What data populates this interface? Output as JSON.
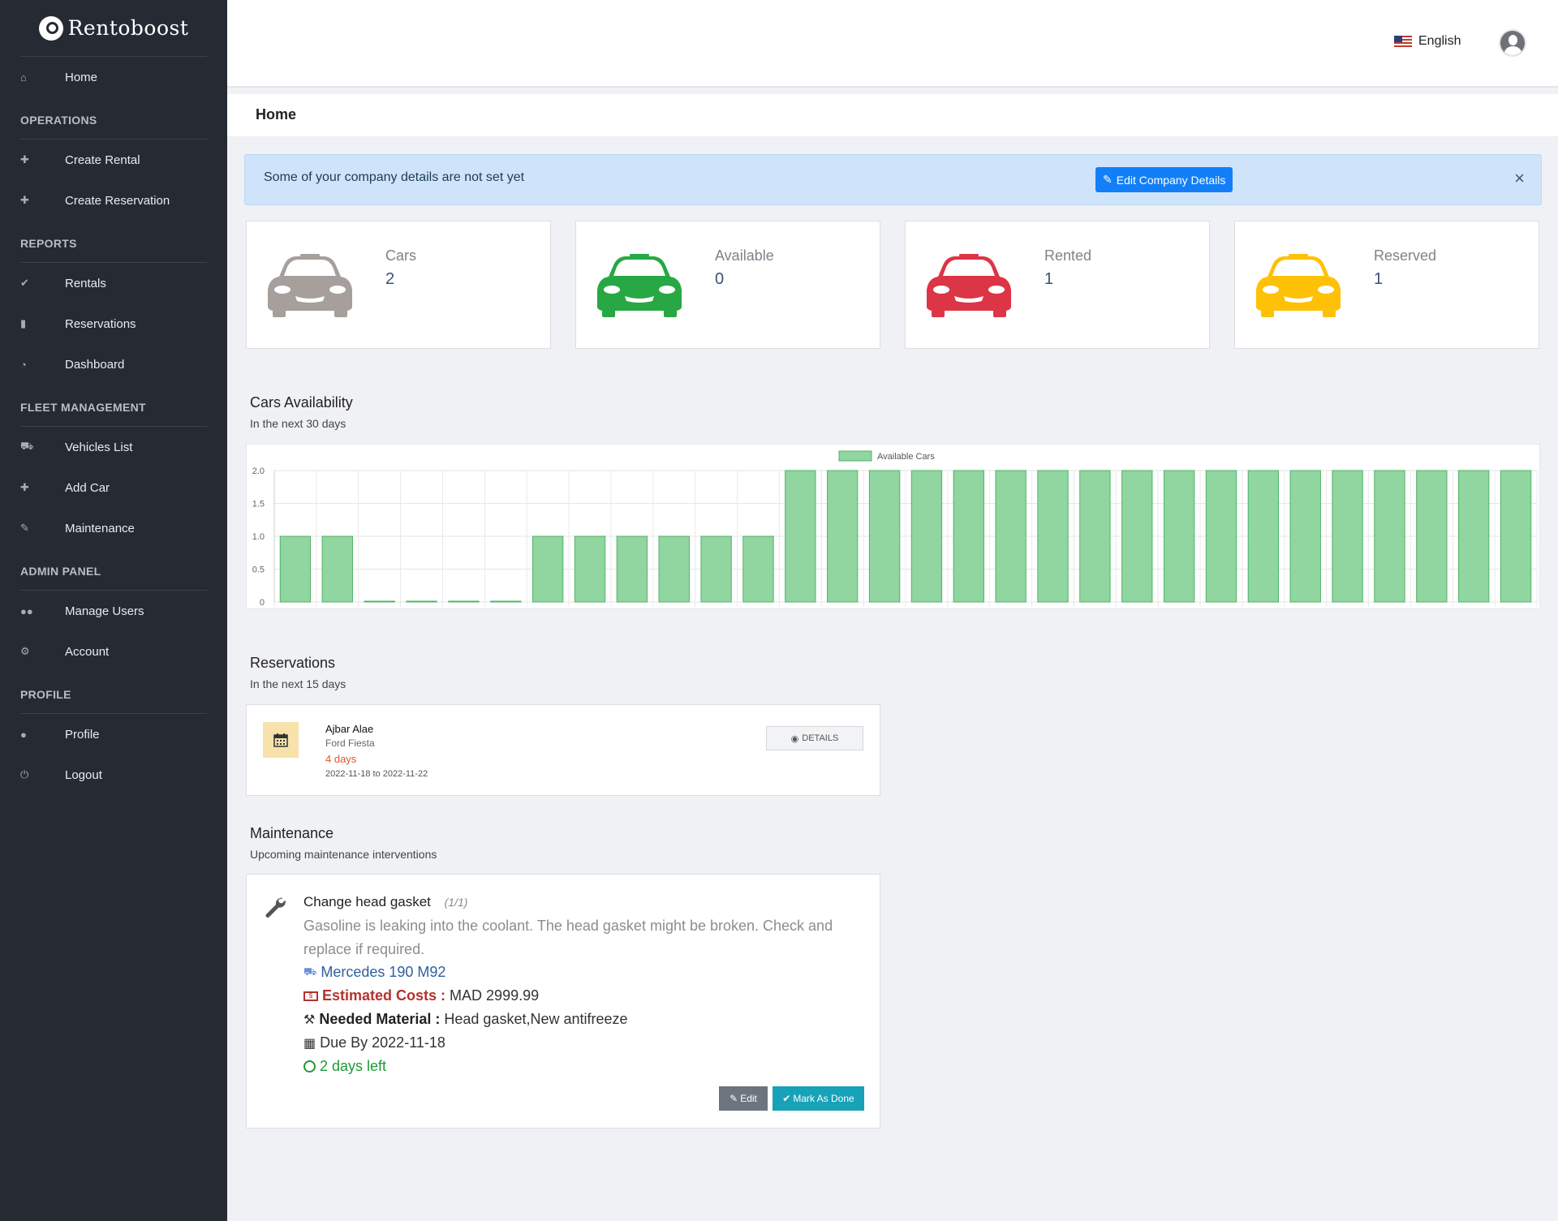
{
  "brand": {
    "name": "Rentoboost"
  },
  "sidebar": {
    "home": {
      "label": "Home",
      "icon": "home-icon"
    },
    "groups": [
      {
        "heading": "OPERATIONS",
        "items": [
          {
            "label": "Create Rental",
            "icon": "plus-icon"
          },
          {
            "label": "Create Reservation",
            "icon": "plus-icon"
          }
        ]
      },
      {
        "heading": "REPORTS",
        "items": [
          {
            "label": "Rentals",
            "icon": "check-icon"
          },
          {
            "label": "Reservations",
            "icon": "bookmark-icon"
          },
          {
            "label": "Dashboard",
            "icon": "dashboard-icon"
          }
        ]
      },
      {
        "heading": "FLEET MANAGEMENT",
        "items": [
          {
            "label": "Vehicles List",
            "icon": "car-icon"
          },
          {
            "label": "Add Car",
            "icon": "plus-icon"
          },
          {
            "label": "Maintenance",
            "icon": "wrench-icon"
          }
        ]
      },
      {
        "heading": "ADMIN PANEL",
        "items": [
          {
            "label": "Manage Users",
            "icon": "users-icon"
          },
          {
            "label": "Account",
            "icon": "gear-icon"
          }
        ]
      },
      {
        "heading": "PROFILE",
        "items": [
          {
            "label": "Profile",
            "icon": "user-icon"
          },
          {
            "label": "Logout",
            "icon": "power-icon"
          }
        ]
      }
    ]
  },
  "topbar": {
    "language": "English",
    "ellipsis": "- - >"
  },
  "breadcrumb": {
    "title": "Home"
  },
  "alert": {
    "message": "Some of your company details are not set yet",
    "button_label": "Edit Company Details",
    "close": "×"
  },
  "stats": [
    {
      "label": "Cars",
      "value": "2",
      "color": "#a69f9b"
    },
    {
      "label": "Available",
      "value": "0",
      "color": "#27a844"
    },
    {
      "label": "Rented",
      "value": "1",
      "color": "#dc3545"
    },
    {
      "label": "Reserved",
      "value": "1",
      "color": "#fec107"
    }
  ],
  "availability": {
    "title": "Cars Availability",
    "subtitle": "In the next 30 days"
  },
  "chart_data": {
    "type": "bar",
    "series": [
      {
        "name": "Available Cars",
        "values": [
          1,
          1,
          0,
          0,
          0,
          0,
          1,
          1,
          1,
          1,
          1,
          1,
          2,
          2,
          2,
          2,
          2,
          2,
          2,
          2,
          2,
          2,
          2,
          2,
          2,
          2,
          2,
          2,
          2,
          2
        ]
      }
    ],
    "ylim": [
      0,
      2
    ],
    "yticks": [
      "0",
      "0.5",
      "1.0",
      "1.5",
      "2.0"
    ],
    "bar_color": "#91d5a0",
    "bar_border": "#4db567",
    "legend": "top-center",
    "grid": true
  },
  "reservations": {
    "title": "Reservations",
    "subtitle": "In the next 15 days",
    "items": [
      {
        "name": "Ajbar Alae",
        "car": "Ford Fiesta",
        "duration": "4 days",
        "dates": "2022-11-18 to 2022-11-22",
        "button": "DETAILS"
      }
    ]
  },
  "maintenance": {
    "title": "Maintenance",
    "subtitle": "Upcoming maintenance interventions",
    "item": {
      "title": "Change head gasket",
      "count": "(1/1)",
      "description": "Gasoline is leaking into the coolant. The head gasket might be broken. Check and replace if required.",
      "vehicle": "Mercedes 190 M92",
      "cost_label": "Estimated Costs :",
      "cost_value": "MAD 2999.99",
      "material_label": "Needed Material :",
      "material_value": "Head gasket,New antifreeze",
      "due": "Due By 2022-11-18",
      "left": "2 days left",
      "edit_label": "Edit",
      "done_label": "Mark As Done"
    }
  }
}
